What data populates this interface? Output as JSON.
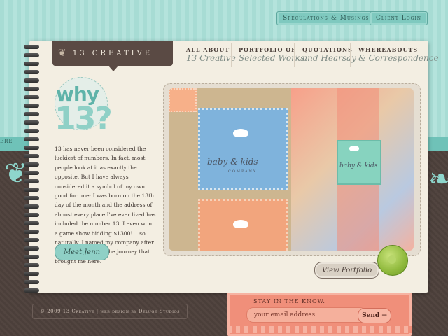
{
  "top_links": {
    "speculations": "Speculations & Musings",
    "client_login": "Client Login"
  },
  "left_edge_text": "ERE",
  "logo": {
    "text": "13 CREATIVE"
  },
  "nav": [
    {
      "line1": "ALL ABOUT",
      "line2": "13 Creative"
    },
    {
      "line1": "PORTFOLIO OF",
      "line2": "Selected Works"
    },
    {
      "line1": "QUOTATIONS",
      "line2": "and Hearsay"
    },
    {
      "line1": "WHEREABOUTS",
      "line2": "& Correspondence"
    }
  ],
  "why": {
    "word": "why",
    "number": "13?"
  },
  "intro_text": "13 has never been considered the luckiest of numbers. In fact, most people look at it as exactly the opposite. But I have always considered it a symbol of my own good fortune: I was born on the 13th day of the month and the address of almost every place I've ever lived has included the number 13. I even won a game show bidding $1300!... so naturally, I named my company after it, to remind me of the journey that brought me here.",
  "meet_button": "Meet Jenn",
  "portfolio": {
    "brand_text": "baby & kids",
    "brand_sub": "COMPANY",
    "view_button": "View Portfolio"
  },
  "footer": {
    "credit": "© 2009 13 Creative | web design by Deluge Studios"
  },
  "signup": {
    "label": "STAY IN THE KNOW.",
    "placeholder": "your email address",
    "send": "Send →"
  }
}
